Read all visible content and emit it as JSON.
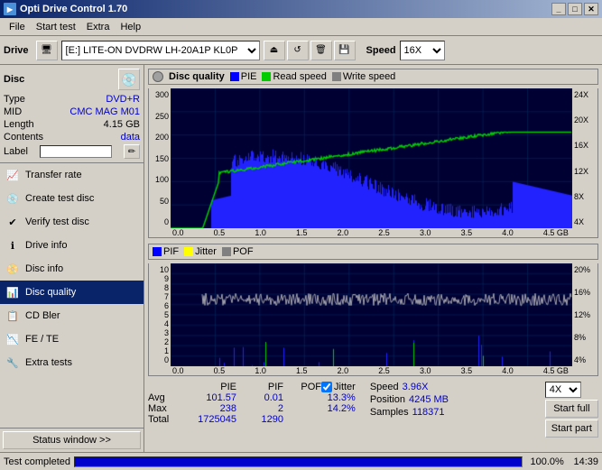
{
  "titlebar": {
    "title": "Opti Drive Control 1.70",
    "icon": "▶",
    "buttons": [
      "_",
      "□",
      "✕"
    ]
  },
  "menubar": {
    "items": [
      "File",
      "Start test",
      "Extra",
      "Help"
    ]
  },
  "drivebar": {
    "drive_label": "Drive",
    "drive_value": "[E:] LITE-ON DVDRW LH-20A1P KL0P",
    "speed_label": "Speed",
    "speed_value": "16X"
  },
  "disc": {
    "title": "Disc",
    "type_label": "Type",
    "type_value": "DVD+R",
    "mid_label": "MID",
    "mid_value": "CMC MAG M01",
    "length_label": "Length",
    "length_value": "4.15 GB",
    "contents_label": "Contents",
    "contents_value": "data",
    "label_label": "Label"
  },
  "nav": {
    "items": [
      {
        "label": "Transfer rate",
        "icon": "📈",
        "id": "transfer-rate",
        "active": false
      },
      {
        "label": "Create test disc",
        "icon": "💿",
        "id": "create-test-disc",
        "active": false
      },
      {
        "label": "Verify test disc",
        "icon": "✔",
        "id": "verify-test-disc",
        "active": false
      },
      {
        "label": "Drive info",
        "icon": "ℹ",
        "id": "drive-info",
        "active": false
      },
      {
        "label": "Disc info",
        "icon": "📀",
        "id": "disc-info",
        "active": false
      },
      {
        "label": "Disc quality",
        "icon": "📊",
        "id": "disc-quality",
        "active": true
      },
      {
        "label": "CD Bler",
        "icon": "📋",
        "id": "cd-bler",
        "active": false
      },
      {
        "label": "FE / TE",
        "icon": "📉",
        "id": "fe-te",
        "active": false
      },
      {
        "label": "Extra tests",
        "icon": "🔧",
        "id": "extra-tests",
        "active": false
      }
    ]
  },
  "chart1": {
    "title": "Disc quality",
    "legend": [
      {
        "label": "PIE",
        "color": "#0000ff"
      },
      {
        "label": "Read speed",
        "color": "#00ff00"
      },
      {
        "label": "Write speed",
        "color": "#808080"
      }
    ],
    "yaxis_left": [
      "300",
      "250",
      "200",
      "150",
      "100",
      "50",
      "0"
    ],
    "yaxis_right": [
      "24X",
      "20X",
      "16X",
      "12X",
      "8X",
      "4X"
    ],
    "xaxis": [
      "0.0",
      "0.5",
      "1.0",
      "1.5",
      "2.0",
      "2.5",
      "3.0",
      "3.5",
      "4.0",
      "4.5 GB"
    ]
  },
  "chart2": {
    "legend": [
      {
        "label": "PIF",
        "color": "#0000ff"
      },
      {
        "label": "Jitter",
        "color": "#ffff00"
      },
      {
        "label": "POF",
        "color": "#808080"
      }
    ],
    "yaxis_left": [
      "10",
      "9",
      "8",
      "7",
      "6",
      "5",
      "4",
      "3",
      "2",
      "1",
      "0"
    ],
    "yaxis_right": [
      "20%",
      "16%",
      "12%",
      "8%",
      "4%"
    ],
    "xaxis": [
      "0.0",
      "0.5",
      "1.0",
      "1.5",
      "2.0",
      "2.5",
      "3.0",
      "3.5",
      "4.0",
      "4.5 GB"
    ]
  },
  "stats": {
    "headers": [
      "",
      "PIE",
      "PIF",
      "POF",
      "",
      "Jitter"
    ],
    "rows": [
      {
        "label": "Avg",
        "pie": "101.57",
        "pif": "0.01",
        "pof": "",
        "jitter": "13.3%"
      },
      {
        "label": "Max",
        "pie": "238",
        "pif": "2",
        "pof": "",
        "jitter": "14.2%"
      },
      {
        "label": "Total",
        "pie": "1725045",
        "pif": "1290",
        "pof": "",
        "jitter": ""
      }
    ],
    "speed_label": "Speed",
    "speed_value": "3.96X",
    "position_label": "Position",
    "position_value": "4245 MB",
    "samples_label": "Samples",
    "samples_value": "118371",
    "speed_select": "4X",
    "start_full": "Start full",
    "start_part": "Start part"
  },
  "statusbar": {
    "text": "Test completed",
    "progress": 100,
    "percent": "100.0%",
    "time": "14:39"
  }
}
